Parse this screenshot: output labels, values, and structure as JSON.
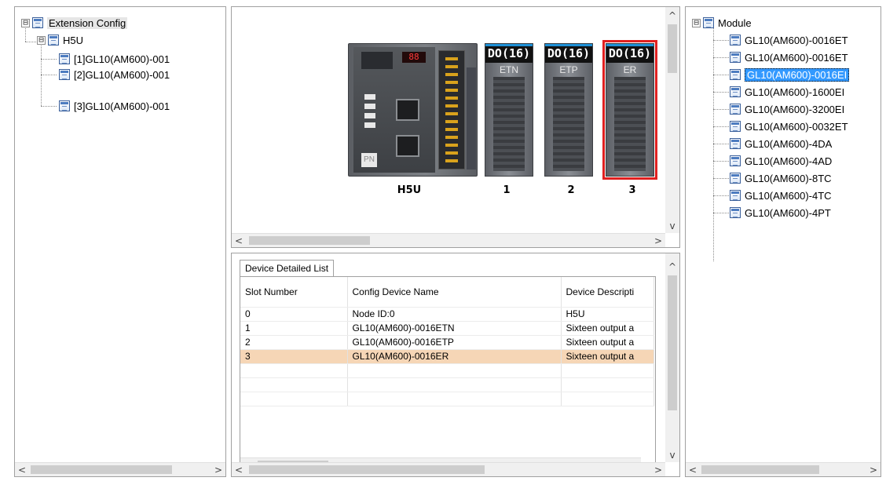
{
  "left_tree": {
    "root_label": "Extension Config",
    "child_label": "H5U",
    "items": [
      {
        "label": "[1]GL10(AM600)-001"
      },
      {
        "label": "[2]GL10(AM600)-001"
      },
      {
        "label": "[3]GL10(AM600)-001"
      }
    ]
  },
  "hardware": {
    "cpu_label": "H5U",
    "cpu_display": "88",
    "cpu_badge": "PN",
    "modules": [
      {
        "header": "DO(16)",
        "type": "ETN",
        "slot": "1"
      },
      {
        "header": "DO(16)",
        "type": "ETP",
        "slot": "2"
      },
      {
        "header": "DO(16)",
        "type": "ER",
        "slot": "3",
        "selected": true
      }
    ]
  },
  "detail_list": {
    "tab_label": "Device Detailed List",
    "columns": [
      "Slot Number",
      "Config Device Name",
      "Device Descripti"
    ],
    "rows": [
      {
        "slot": "0",
        "name": "Node ID:0",
        "desc": "H5U"
      },
      {
        "slot": "1",
        "name": "GL10(AM600)-0016ETN",
        "desc": "Sixteen output a"
      },
      {
        "slot": "2",
        "name": "GL10(AM600)-0016ETP",
        "desc": "Sixteen output a"
      },
      {
        "slot": "3",
        "name": "GL10(AM600)-0016ER",
        "desc": "Sixteen output a",
        "selected": true
      }
    ]
  },
  "right_tree": {
    "root_label": "Module",
    "items": [
      {
        "label": "GL10(AM600)-0016ET"
      },
      {
        "label": "GL10(AM600)-0016ET"
      },
      {
        "label": "GL10(AM600)-0016EI",
        "selected": true
      },
      {
        "label": "GL10(AM600)-1600EI"
      },
      {
        "label": "GL10(AM600)-3200EI"
      },
      {
        "label": "GL10(AM600)-0032ET"
      },
      {
        "label": "GL10(AM600)-4DA"
      },
      {
        "label": "GL10(AM600)-4AD"
      },
      {
        "label": "GL10(AM600)-8TC"
      },
      {
        "label": "GL10(AM600)-4TC"
      },
      {
        "label": "GL10(AM600)-4PT"
      }
    ]
  },
  "icons": {
    "expander_expanded": "⊟",
    "arrow_left": "<",
    "arrow_right": ">",
    "arrow_up": "^",
    "arrow_down": "v"
  },
  "colors": {
    "selection_blue": "#3399ff",
    "row_highlight": "#f6d6b6",
    "module_selected_border": "#e02020"
  }
}
